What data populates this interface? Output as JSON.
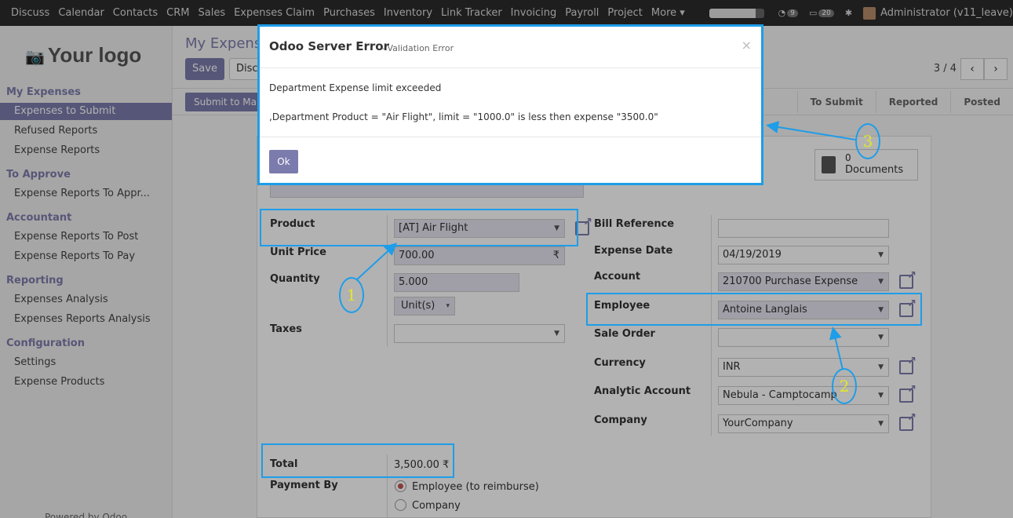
{
  "topbar": {
    "menu": [
      "Discuss",
      "Calendar",
      "Contacts",
      "CRM",
      "Sales",
      "Expenses Claim",
      "Purchases",
      "Inventory",
      "Link Tracker",
      "Invoicing",
      "Payroll",
      "Project",
      "More ▾"
    ],
    "badges": [
      "9",
      "20"
    ],
    "user": "Administrator (v11_leave)"
  },
  "sidebar": {
    "logo": "Your logo",
    "sections": [
      {
        "title": "My Expenses",
        "items": [
          "Expenses to Submit",
          "Refused Reports",
          "Expense Reports"
        ]
      },
      {
        "title": "To Approve",
        "items": [
          "Expense Reports To Appr..."
        ]
      },
      {
        "title": "Accountant",
        "items": [
          "Expense Reports To Post",
          "Expense Reports To Pay"
        ]
      },
      {
        "title": "Reporting",
        "items": [
          "Expenses Analysis",
          "Expenses Reports Analysis"
        ]
      },
      {
        "title": "Configuration",
        "items": [
          "Settings",
          "Expense Products"
        ]
      }
    ],
    "powered": "Powered by Odoo"
  },
  "main": {
    "breadcrumb": "My Expense",
    "save": "Save",
    "discard": "Disca",
    "pager": "3 / 4",
    "prev": "‹",
    "next": "›",
    "submit": "Submit to Mana",
    "statuses": [
      "To Submit",
      "Reported",
      "Posted"
    ],
    "documents_count": "0",
    "documents_label": "Documents"
  },
  "form": {
    "product_label": "Product",
    "product": "[AT] Air Flight",
    "unit_price_label": "Unit Price",
    "unit_price": "700.00",
    "currency_symbol": "₹",
    "quantity_label": "Quantity",
    "quantity": "5.000",
    "uom": "Unit(s)",
    "taxes_label": "Taxes",
    "bill_ref_label": "Bill Reference",
    "expense_date_label": "Expense Date",
    "expense_date": "04/19/2019",
    "account_label": "Account",
    "account": "210700 Purchase Expense",
    "employee_label": "Employee",
    "employee": "Antoine Langlais",
    "sale_order_label": "Sale Order",
    "currency_label": "Currency",
    "currency": "INR",
    "analytic_label": "Analytic Account",
    "analytic": "Nebula - Camptocamp",
    "company_label": "Company",
    "company": "YourCompany",
    "total_label": "Total",
    "total": "3,500.00 ₹",
    "payment_by_label": "Payment By",
    "payment_opt1": "Employee (to reimburse)",
    "payment_opt2": "Company"
  },
  "modal": {
    "title": "Odoo Server Error",
    "subtitle": "- Validation Error",
    "close": "×",
    "line1": "Department Expense limit exceeded",
    "line2": ",Department Product = \"Air Flight\", limit = \"1000.0\" is less then expense \"3500.0\"",
    "ok": "Ok"
  },
  "annotations": [
    "1",
    "2",
    "3"
  ],
  "colors": {
    "accent": "#7c7bad",
    "highlight": "#1e9de8",
    "topbar": "#2b2b2b"
  }
}
